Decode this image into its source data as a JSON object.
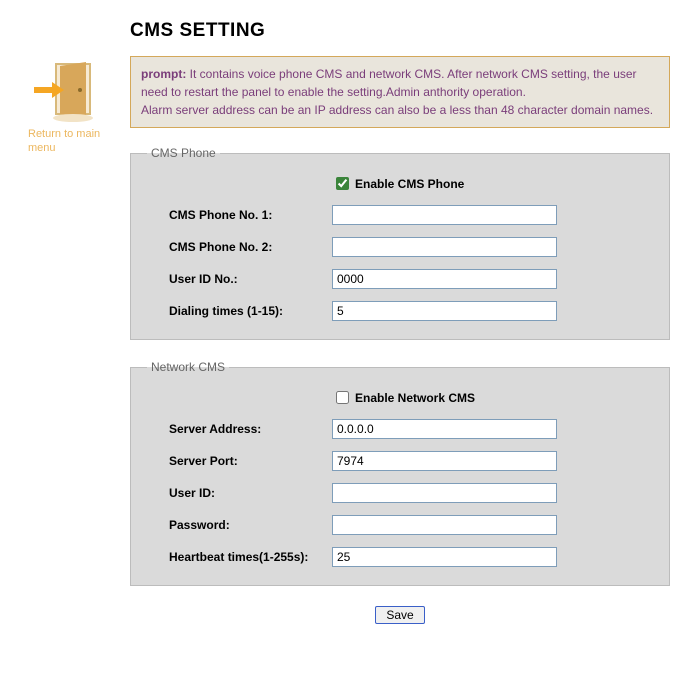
{
  "title": "CMS SETTING",
  "return_link": "Return to main menu",
  "prompt": {
    "label": "prompt:",
    "text1": " It contains voice phone CMS and network CMS. After network CMS setting, the user need to restart the panel to enable the setting.Admin anthority operation.",
    "text2": "Alarm server address can be an IP address can also be a less than 48 character domain names."
  },
  "cms_phone": {
    "legend": "CMS Phone",
    "enable_label": "Enable CMS Phone",
    "enable_checked": true,
    "fields": {
      "phone1_label": "CMS Phone No. 1:",
      "phone1_value": "",
      "phone2_label": "CMS Phone No. 2:",
      "phone2_value": "",
      "userid_label": "User ID No.:",
      "userid_value": "0000",
      "dialing_label": "Dialing times (1-15):",
      "dialing_value": "5"
    }
  },
  "network_cms": {
    "legend": "Network CMS",
    "enable_label": "Enable Network CMS",
    "enable_checked": false,
    "fields": {
      "server_addr_label": "Server Address:",
      "server_addr_value": "0.0.0.0",
      "server_port_label": "Server Port:",
      "server_port_value": "7974",
      "userid_label": "User ID:",
      "userid_value": "",
      "password_label": "Password:",
      "password_value": "",
      "heartbeat_label": "Heartbeat times(1-255s):",
      "heartbeat_value": "25"
    }
  },
  "save_label": "Save"
}
